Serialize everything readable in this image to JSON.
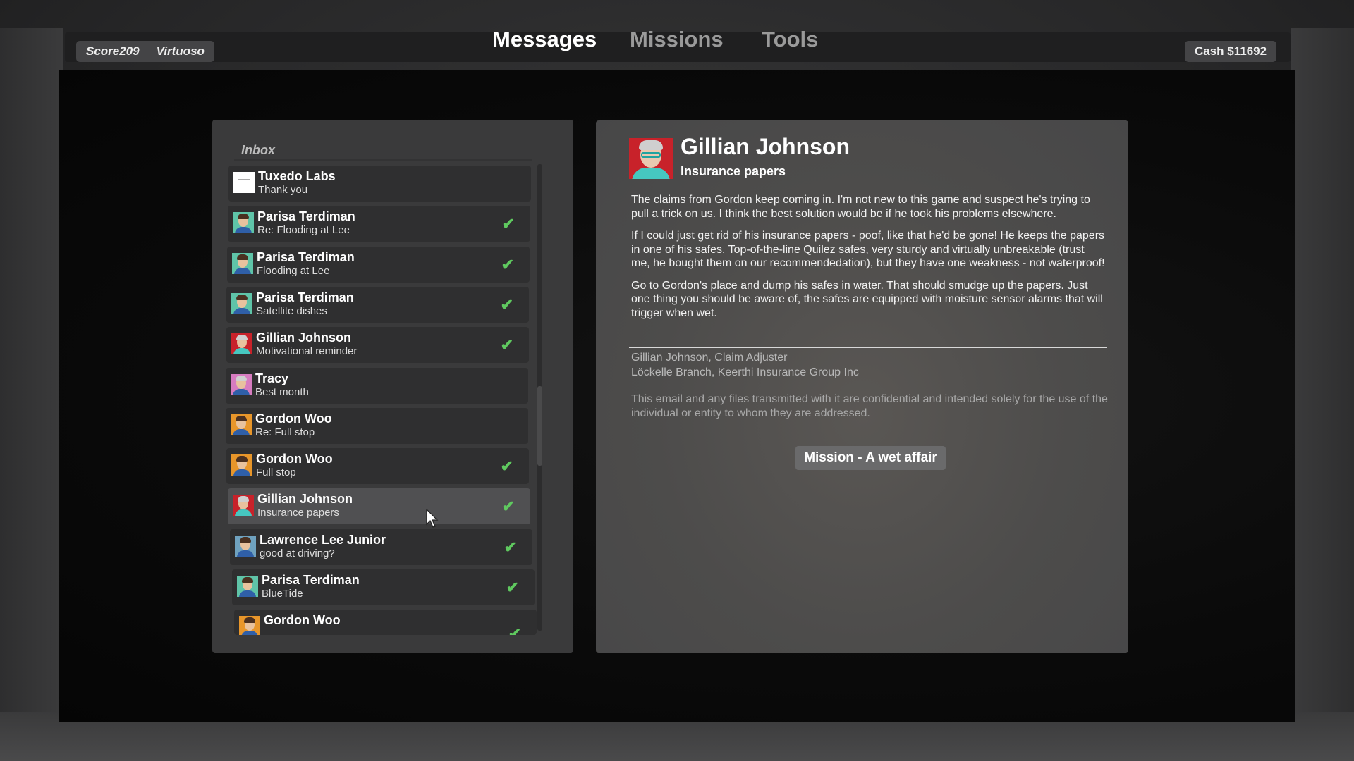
{
  "topbar": {
    "score": "Score209",
    "rank": "Virtuoso",
    "cash": "Cash $11692",
    "tabs": [
      {
        "label": "Messages",
        "active": true
      },
      {
        "label": "Missions",
        "active": false
      },
      {
        "label": "Tools",
        "active": false
      }
    ]
  },
  "inbox": {
    "label": "Inbox",
    "items": [
      {
        "sender": "Tuxedo Labs",
        "subject": "Thank you",
        "read": false,
        "avatar_color": "#ffffff"
      },
      {
        "sender": "Parisa Terdiman",
        "subject": "Re: Flooding at Lee",
        "read": true,
        "avatar_color": "#5fc4a8"
      },
      {
        "sender": "Parisa Terdiman",
        "subject": "Flooding at Lee",
        "read": true,
        "avatar_color": "#5fc4a8"
      },
      {
        "sender": "Parisa Terdiman",
        "subject": "Satellite dishes",
        "read": true,
        "avatar_color": "#5fc4a8"
      },
      {
        "sender": "Gillian Johnson",
        "subject": "Motivational reminder",
        "read": true,
        "avatar_color": "#c8222a"
      },
      {
        "sender": "Tracy",
        "subject": "Best month",
        "read": false,
        "avatar_color": "#d77cc0"
      },
      {
        "sender": "Gordon Woo",
        "subject": "Re: Full stop",
        "read": false,
        "avatar_color": "#e8962a"
      },
      {
        "sender": "Gordon Woo",
        "subject": "Full stop",
        "read": true,
        "avatar_color": "#e8962a"
      },
      {
        "sender": "Gillian Johnson",
        "subject": "Insurance papers",
        "read": true,
        "selected": true,
        "avatar_color": "#c8222a"
      },
      {
        "sender": "Lawrence Lee Junior",
        "subject": "good at driving?",
        "read": true,
        "avatar_color": "#6fa2bf"
      },
      {
        "sender": "Parisa Terdiman",
        "subject": "BlueTide",
        "read": true,
        "avatar_color": "#5fc4a8"
      },
      {
        "sender": "Gordon Woo",
        "subject": "",
        "read": true,
        "avatar_color": "#e8962a"
      }
    ]
  },
  "message": {
    "sender": "Gillian Johnson",
    "subject": "Insurance papers",
    "paragraphs": [
      "The claims from Gordon keep coming in. I'm not new to this game and suspect he's trying to pull a trick on us. I think the best solution would be if he took his problems elsewhere.",
      "If I could just get rid of his insurance papers - poof, like that he'd be gone! He keeps the papers in one of his safes. Top-of-the-line Quilez safes, very sturdy and virtually unbreakable (trust me, he bought them on our recommendedation), but they have one weakness - not waterproof!",
      "Go to Gordon's place and dump his safes in water. That should smudge up the papers. Just one thing you should be aware of, the safes are equipped with moisture sensor alarms that will trigger when wet."
    ],
    "signature_line1": "Gillian Johnson, Claim Adjuster",
    "signature_line2": "Löckelle Branch, Keerthi Insurance Group Inc",
    "disclaimer": "This email and any files transmitted with it are confidential and intended solely for the use of the individual or entity to whom they are addressed.",
    "mission_button": "Mission - A wet affair"
  },
  "colors": {
    "check": "#5fc95f",
    "selected_row": "#505052"
  },
  "icons": {
    "read": "check-icon",
    "cursor": "mouse-pointer-icon"
  }
}
